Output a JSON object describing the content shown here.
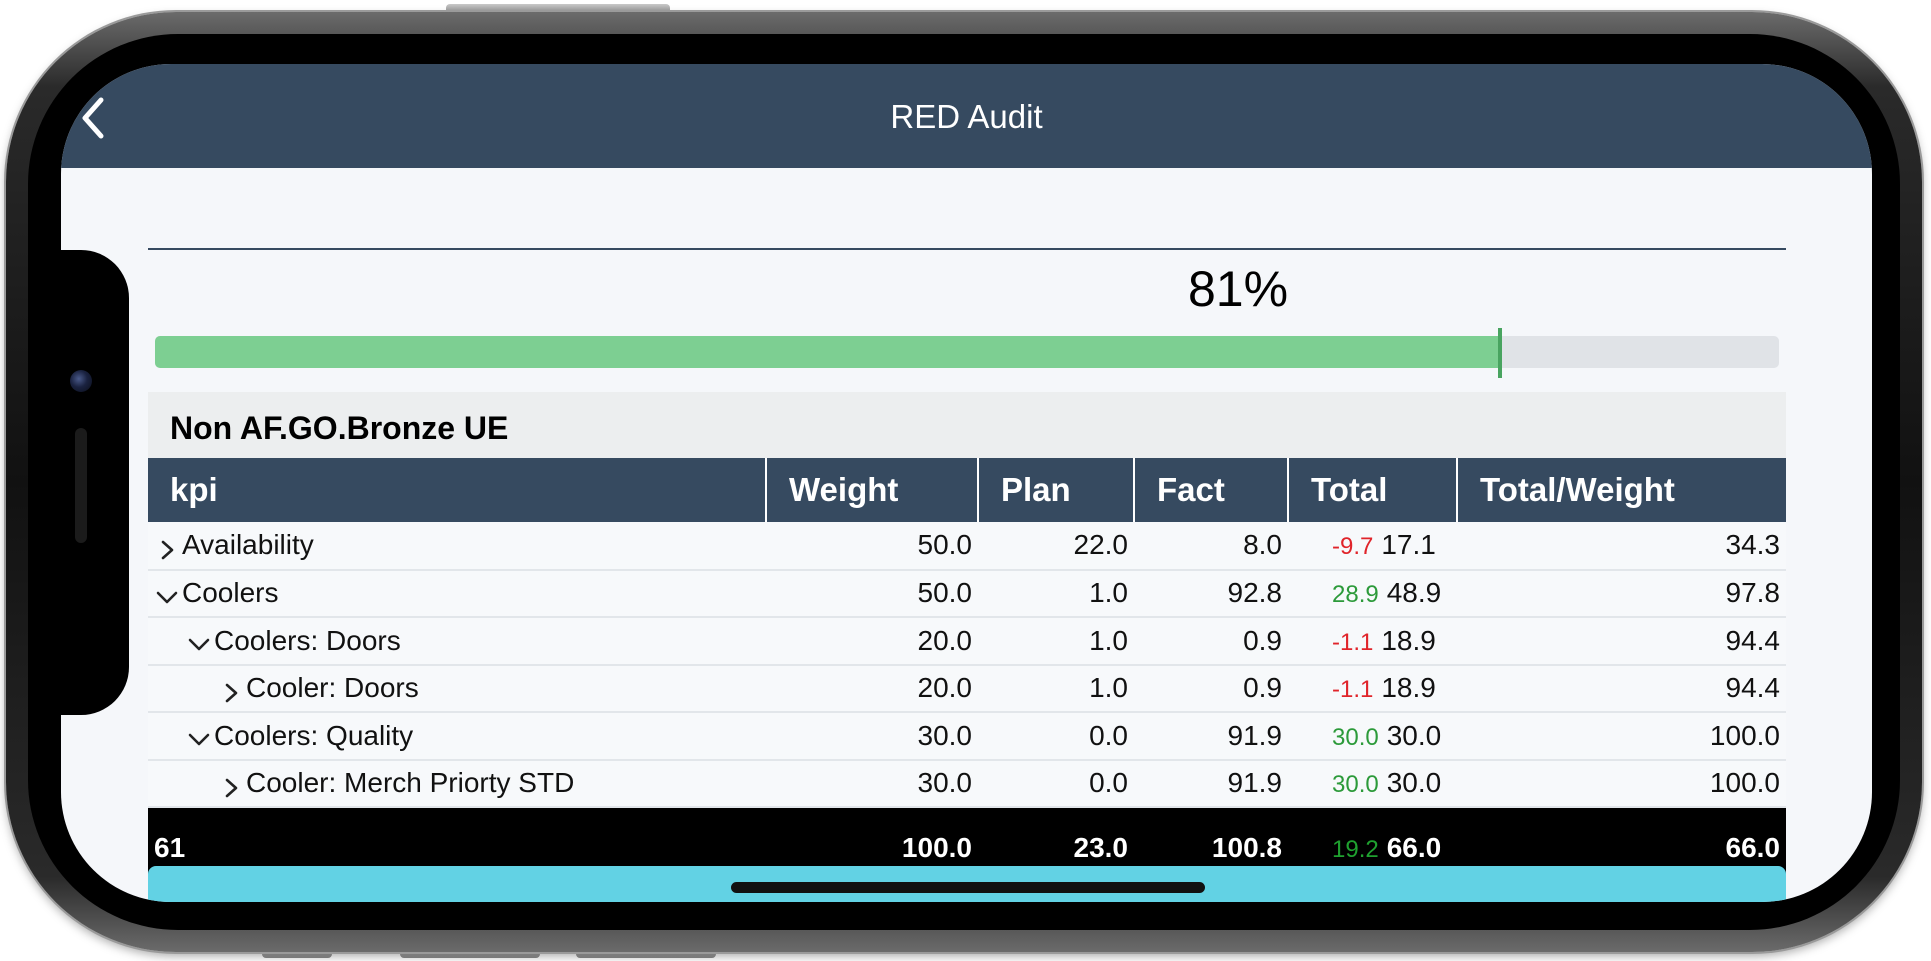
{
  "nav": {
    "title": "RED Audit",
    "back_icon": "chevron-left-icon"
  },
  "progress": {
    "label": "81%",
    "value_percent": 82.8,
    "colors": {
      "fill": "#7dcf92",
      "track": "#e0e3e7",
      "marker": "#49a460"
    }
  },
  "group": {
    "title": "Non AF.GO.Bronze UE"
  },
  "table": {
    "headers": [
      "kpi",
      "Weight",
      "Plan",
      "Fact",
      "Total",
      "Total/Weight"
    ],
    "rows": [
      {
        "kpi": "Availability",
        "level": 0,
        "expanded": false,
        "weight": "50.0",
        "plan": "22.0",
        "fact": "8.0",
        "delta": "-9.7",
        "delta_sign": "neg",
        "total": "17.1",
        "total_weight": "34.3"
      },
      {
        "kpi": "Coolers",
        "level": 0,
        "expanded": true,
        "weight": "50.0",
        "plan": "1.0",
        "fact": "92.8",
        "delta": "28.9",
        "delta_sign": "pos",
        "total": "48.9",
        "total_weight": "97.8"
      },
      {
        "kpi": "Coolers: Doors",
        "level": 1,
        "expanded": true,
        "weight": "20.0",
        "plan": "1.0",
        "fact": "0.9",
        "delta": "-1.1",
        "delta_sign": "neg",
        "total": "18.9",
        "total_weight": "94.4"
      },
      {
        "kpi": "Cooler: Doors",
        "level": 2,
        "expanded": false,
        "weight": "20.0",
        "plan": "1.0",
        "fact": "0.9",
        "delta": "-1.1",
        "delta_sign": "neg",
        "total": "18.9",
        "total_weight": "94.4"
      },
      {
        "kpi": "Coolers: Quality",
        "level": 1,
        "expanded": true,
        "weight": "30.0",
        "plan": "0.0",
        "fact": "91.9",
        "delta": "30.0",
        "delta_sign": "pos",
        "total": "30.0",
        "total_weight": "100.0"
      },
      {
        "kpi": "Cooler: Merch Priorty STD",
        "level": 2,
        "expanded": false,
        "weight": "30.0",
        "plan": "0.0",
        "fact": "91.9",
        "delta": "30.0",
        "delta_sign": "pos",
        "total": "30.0",
        "total_weight": "100.0"
      }
    ],
    "footer": {
      "kpi": "61",
      "weight": "100.0",
      "plan": "23.0",
      "fact": "100.8",
      "delta": "19.2",
      "total": "66.0",
      "total_weight": "66.0"
    }
  },
  "colors": {
    "navbar": "#364a60",
    "bottom_bar": "#62d2e4",
    "negative": "#e0242a",
    "positive": "#2c9a3a"
  }
}
